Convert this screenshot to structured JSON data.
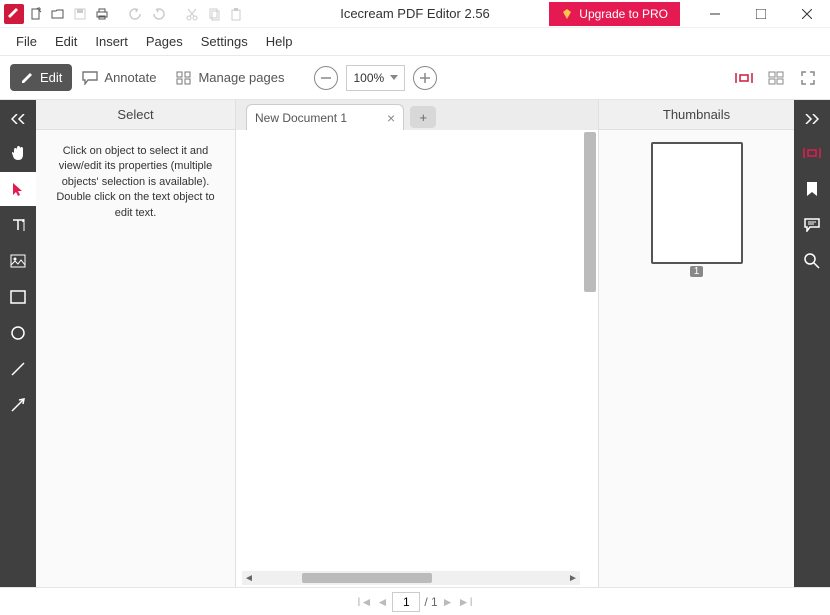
{
  "app": {
    "title": "Icecream PDF Editor 2.56",
    "upgrade_label": "Upgrade to PRO"
  },
  "menu": {
    "file": "File",
    "edit": "Edit",
    "insert": "Insert",
    "pages": "Pages",
    "settings": "Settings",
    "help": "Help"
  },
  "toolbar": {
    "edit_label": "Edit",
    "annotate_label": "Annotate",
    "manage_label": "Manage pages",
    "zoom_value": "100%"
  },
  "sidebar": {
    "title": "Select",
    "hint": "Click on object to select it and view/edit its properties (multiple objects' selection is available). Double click on the text object to edit text."
  },
  "tabs": {
    "active_label": "New Document 1"
  },
  "thumbnails": {
    "title": "Thumbnails",
    "items": [
      {
        "num": "1"
      }
    ]
  },
  "status": {
    "page": "1",
    "total": "/ 1"
  }
}
